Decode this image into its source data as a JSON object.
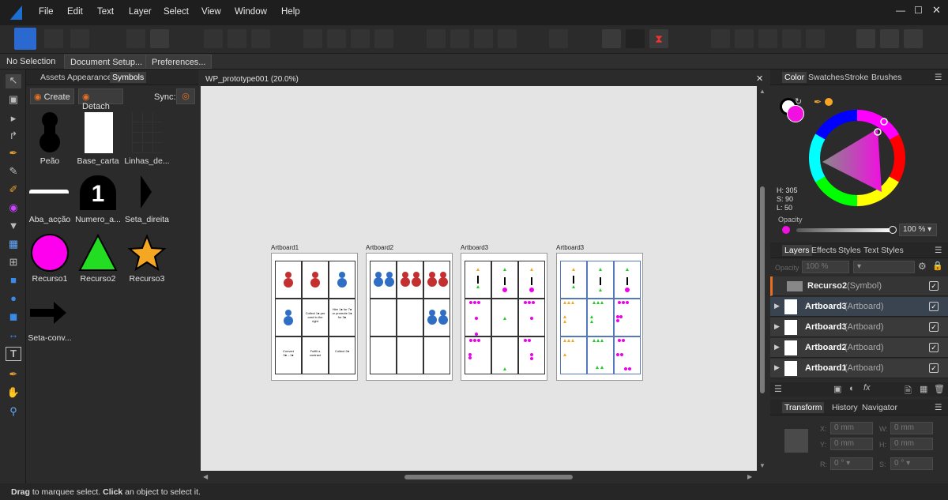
{
  "menu": [
    "File",
    "Edit",
    "Text",
    "Layer",
    "Select",
    "View",
    "Window",
    "Help"
  ],
  "context_bar": {
    "selection": "No Selection",
    "document_setup": "Document Setup...",
    "preferences": "Preferences..."
  },
  "left_panel": {
    "tabs": [
      "Assets",
      "Appearance",
      "Symbols"
    ],
    "create_label": "Create",
    "detach_label": "Detach",
    "sync_label": "Sync:",
    "symbols": [
      "Peão",
      "Base_carta",
      "Linhas_de...",
      "Aba_acção",
      "Numero_a...",
      "Seta_direita",
      "Recurso1",
      "Recurso2",
      "Recurso3",
      "Seta-conv..."
    ],
    "numero_glyph": "1"
  },
  "document": {
    "tab_title": "WP_prototype001 (20.0%)",
    "artboards": [
      "Artboard1",
      "Artboard2",
      "Artboard3",
      "Artboard3"
    ]
  },
  "card_text": {
    "a": "Collect 1● per card to the right",
    "b": "Hire 1● for 7● or promote 1● for 3●",
    "c": "Convert 3●→1●",
    "d": "Fulfill a contract",
    "e": "Collect 2●"
  },
  "color_panel": {
    "tabs": [
      "Color",
      "Swatches",
      "Stroke",
      "Brushes"
    ],
    "h": "H: 305",
    "s": "S: 90",
    "l": "L: 50",
    "opacity_label": "Opacity",
    "opacity_value": "100 %",
    "fill_color": "#f010e0"
  },
  "layers_panel": {
    "tabs": [
      "Layers",
      "Effects",
      "Styles",
      "Text Styles"
    ],
    "opacity_label": "Opacity",
    "opacity_value": "100 %",
    "layers": [
      {
        "name": "Recurso2",
        "type": " (Symbol)"
      },
      {
        "name": "Artboard3",
        "type": " (Artboard)"
      },
      {
        "name": "Artboard3",
        "type": " (Artboard)"
      },
      {
        "name": "Artboard2",
        "type": " (Artboard)"
      },
      {
        "name": "Artboard1",
        "type": " (Artboard)"
      }
    ]
  },
  "transform_panel": {
    "tabs": [
      "Transform",
      "History",
      "Navigator"
    ],
    "x_label": "X:",
    "y_label": "Y:",
    "w_label": "W:",
    "h_label": "H:",
    "r_label": "R:",
    "s_label": "S:",
    "x": "0 mm",
    "y": "0 mm",
    "w": "0 mm",
    "h": "0 mm",
    "r": "0 °",
    "s": "0 °"
  },
  "status": {
    "b1": "Drag",
    "t1": " to marquee select. ",
    "b2": "Click",
    "t2": " an object to select it."
  }
}
